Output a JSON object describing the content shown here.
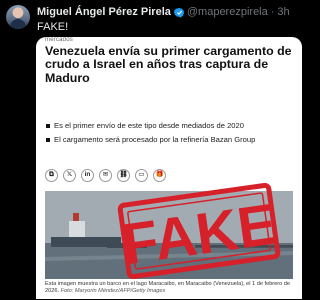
{
  "author": {
    "name": "Miguel Ángel Pérez Pirela",
    "handle": "@maperezpirela",
    "separator": "·",
    "time": "3h",
    "verified": true
  },
  "tweet": {
    "text": "FAKE!"
  },
  "article": {
    "kicker": "mercados",
    "headline": "Venezuela envía su primer cargamento de crudo a Israel en años tras captura de Maduro",
    "bullets": [
      "Es el primer envío de este tipo desde mediados de 2020",
      "El cargamento será procesado por la refinería Bazan Group"
    ],
    "share_icons": [
      "copy-icon",
      "x-icon",
      "linkedin-icon",
      "email-icon",
      "link-icon",
      "chat-icon",
      "gift-icon"
    ],
    "share_glyphs": [
      "⧉",
      "𝕏",
      "in",
      "✉",
      "⛓",
      "▭",
      "🎁"
    ],
    "caption": "Esta imagen muestra un barco en el lago Maracaibo, en Maracaibo (Venezuela), el 1 de febrero de 2026.",
    "credit": "Foto: Maryorin Méndez/AFP/Getty Images"
  },
  "stamp": {
    "text": "FAKE",
    "color": "#d6202a"
  },
  "colors": {
    "background": "#000000",
    "primary_text": "#e7e9ea",
    "secondary_text": "#71767b",
    "verified_blue": "#1d9bf0"
  }
}
